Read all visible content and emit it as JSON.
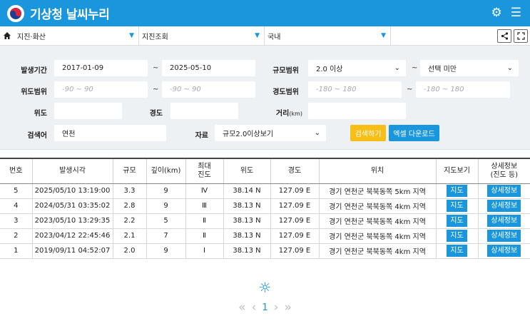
{
  "header": {
    "title": "기상청 날씨누리",
    "settings_icon": "gear-icon",
    "menu_icon": "hamburger-menu-icon"
  },
  "nav": {
    "selects": [
      "지진·화산",
      "지진조회",
      "국내"
    ]
  },
  "search": {
    "period_label": "발생기간",
    "period_from": "2017-01-09",
    "period_to": "2025-05-10",
    "magnitude_label": "규모범위",
    "magnitude_from": "2.0 이상",
    "magnitude_to": "선택 미만",
    "lat_range_label": "위도범위",
    "lat_from_ph": "-90 ~ 90",
    "lat_to_ph": "-90 ~ 90",
    "lon_range_label": "경도범위",
    "lon_from_ph": "-180 ~ 180",
    "lon_to_ph": "-180 ~ 180",
    "lat_label": "위도",
    "lon_label": "경도",
    "dist_label": "거리",
    "dist_unit": "(km)",
    "keyword_label": "검색어",
    "keyword_value": "연천",
    "data_label": "자료",
    "data_value": "규모2.0이상보기",
    "search_button": "검색하기",
    "excel_button": "엑셀 다운로드",
    "tilde": "~"
  },
  "table": {
    "headers": [
      "번호",
      "발생시각",
      "규모",
      "깊이(km)",
      "최대\n진도",
      "위도",
      "경도",
      "위치",
      "지도보기",
      "상세정보\n(진도 등)"
    ],
    "rows": [
      {
        "no": "5",
        "time": "2025/05/10 13:19:00",
        "mag": "3.3",
        "depth": "9",
        "intensity": "Ⅳ",
        "lat": "38.14 N",
        "lon": "127.09 E",
        "loc": "경기 연천군 북북동쪽 5km 지역",
        "map": "지도",
        "detail": "상세정보"
      },
      {
        "no": "4",
        "time": "2024/05/31 03:35:02",
        "mag": "2.8",
        "depth": "9",
        "intensity": "Ⅲ",
        "lat": "38.13 N",
        "lon": "127.09 E",
        "loc": "경기 연천군 북북동쪽 4km 지역",
        "map": "지도",
        "detail": "상세정보"
      },
      {
        "no": "3",
        "time": "2023/05/10 13:29:35",
        "mag": "2.2",
        "depth": "5",
        "intensity": "Ⅱ",
        "lat": "38.13 N",
        "lon": "127.09 E",
        "loc": "경기 연천군 북북동쪽 4km 지역",
        "map": "지도",
        "detail": "상세정보"
      },
      {
        "no": "2",
        "time": "2023/04/12 22:45:46",
        "mag": "2.1",
        "depth": "7",
        "intensity": "Ⅱ",
        "lat": "38.13 N",
        "lon": "127.09 E",
        "loc": "경기 연천군 북북동쪽 4km 지역",
        "map": "지도",
        "detail": "상세정보"
      },
      {
        "no": "1",
        "time": "2019/09/11 04:52:07",
        "mag": "2.0",
        "depth": "9",
        "intensity": "Ⅰ",
        "lat": "38.13 N",
        "lon": "127.09 E",
        "loc": "경기 연천군 북북동쪽 4km 지역",
        "map": "지도",
        "detail": "상세정보"
      }
    ]
  },
  "pager": {
    "current": "1"
  },
  "colors": {
    "brand": "#1a96dc",
    "search_button": "#f7be16",
    "panel_bg": "#eef1f4"
  }
}
